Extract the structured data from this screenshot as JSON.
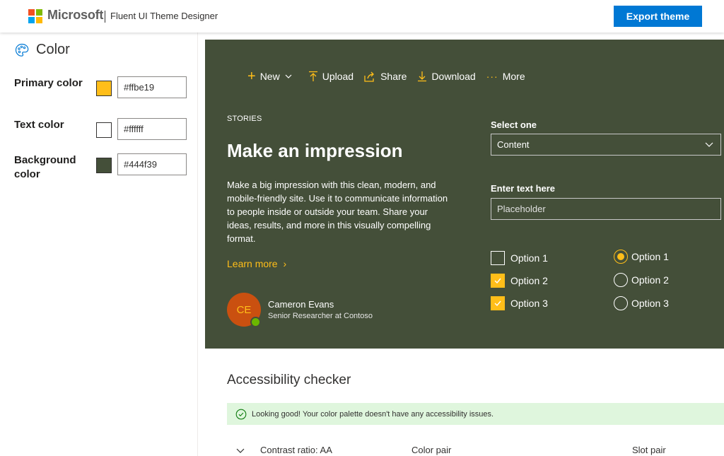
{
  "header": {
    "brand": "Microsoft",
    "product": "Fluent UI Theme Designer",
    "export_label": "Export theme",
    "logo_colors": [
      "#f25022",
      "#7fba00",
      "#00a4ef",
      "#ffb900"
    ]
  },
  "sidebar": {
    "section_title": "Color",
    "rows": [
      {
        "label": "Primary color",
        "swatch": "#ffbe19",
        "value": "#ffbe19"
      },
      {
        "label": "Text color",
        "swatch": "#ffffff",
        "value": "#ffffff"
      },
      {
        "label": "Background color",
        "swatch": "#444f39",
        "value": "#444f39"
      }
    ]
  },
  "preview": {
    "commands": [
      "New",
      "Upload",
      "Share",
      "Download",
      "More"
    ],
    "eyebrow": "STORIES",
    "headline": "Make an impression",
    "description": "Make a big impression with this clean, modern, and mobile-friendly site. Use it to communicate information to people inside or outside your team. Share your ideas, results, and more in this visually compelling format.",
    "learn_more": "Learn more",
    "persona": {
      "initials": "CE",
      "name": "Cameron Evans",
      "role": "Senior Researcher at Contoso"
    },
    "select_label": "Select one",
    "select_value": "Content",
    "text_label": "Enter text here",
    "text_placeholder": "Placeholder",
    "checkboxes": [
      {
        "label": "Option 1",
        "checked": false
      },
      {
        "label": "Option 2",
        "checked": true
      },
      {
        "label": "Option 3",
        "checked": true
      }
    ],
    "radios": [
      {
        "label": "Option 1",
        "selected": true
      },
      {
        "label": "Option 2",
        "selected": false
      },
      {
        "label": "Option 3",
        "selected": false
      }
    ]
  },
  "accessibility": {
    "title": "Accessibility checker",
    "status": "Looking good! Your color palette doesn't have any accessibility issues.",
    "columns": [
      "Contrast ratio: AA",
      "Color pair",
      "Slot pair"
    ]
  },
  "colors": {
    "primary": "#ffbe19",
    "background": "#444f39",
    "accent_blue": "#0078d4"
  }
}
